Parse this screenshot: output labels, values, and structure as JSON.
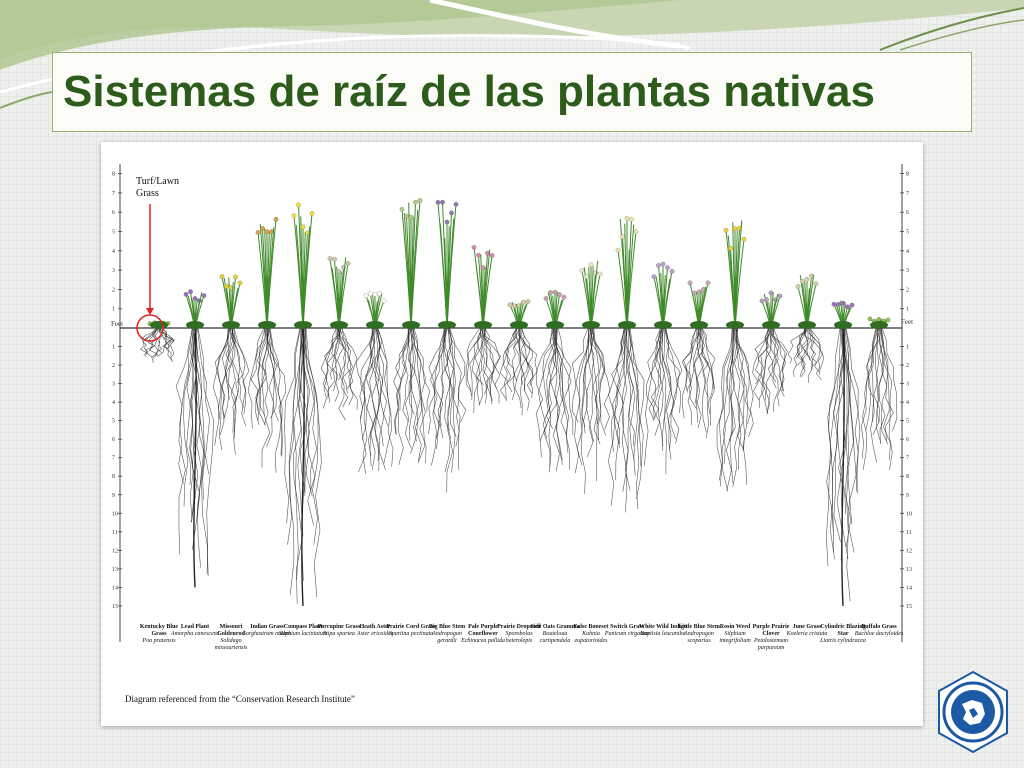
{
  "slide": {
    "title": "Sistemas de raíz de las plantas nativas"
  },
  "diagram": {
    "turf_label": "Turf/Lawn\nGrass",
    "feet_left": "Feet",
    "feet_right": "Feet",
    "caption": "Diagram referenced from the “Conservation Research Institute”",
    "depth_ticks_below": [
      "1",
      "2",
      "3",
      "4",
      "5",
      "6",
      "7",
      "8",
      "9",
      "10",
      "11",
      "12",
      "13",
      "14",
      "15"
    ],
    "height_ticks_above": [
      "1",
      "2",
      "3",
      "4",
      "5",
      "6",
      "7",
      "8"
    ],
    "plants": [
      {
        "common": "Kentucky Blue Grass",
        "scientific": "Poa pratensis",
        "root_depth_ft": 2,
        "height_ft": 0.3,
        "flower": "#7fbf3a"
      },
      {
        "common": "Lead Plant",
        "scientific": "Amorpha canescens",
        "root_depth_ft": 14,
        "height_ft": 2,
        "flower": "#9a6fc4"
      },
      {
        "common": "Missouri Goldenrod",
        "scientific": "Solidago missouriensis",
        "root_depth_ft": 7,
        "height_ft": 3,
        "flower": "#e4d23a"
      },
      {
        "common": "Indian Grass",
        "scientific": "Sorghastrum nutans",
        "root_depth_ft": 8,
        "height_ft": 7,
        "flower": "#d7a24a"
      },
      {
        "common": "Compass Plant",
        "scientific": "Silphium laciniatum",
        "root_depth_ft": 15,
        "height_ft": 7,
        "flower": "#f0e23a"
      },
      {
        "common": "Porcupine Grass",
        "scientific": "Stipa spartea",
        "root_depth_ft": 5,
        "height_ft": 4,
        "flower": "#c9c9b0"
      },
      {
        "common": "Heath Aster",
        "scientific": "Aster ericoides",
        "root_depth_ft": 8,
        "height_ft": 2,
        "flower": "#ffffff"
      },
      {
        "common": "Prairie Cord Grass",
        "scientific": "Spartina pectinata",
        "root_depth_ft": 8,
        "height_ft": 7,
        "flower": "#b9c98a"
      },
      {
        "common": "Big Blue Stem",
        "scientific": "Andropogon gerardii",
        "root_depth_ft": 9,
        "height_ft": 7,
        "flower": "#8a7bb0"
      },
      {
        "common": "Pale Purple Coneflower",
        "scientific": "Echinacea pallida",
        "root_depth_ft": 5,
        "height_ft": 4.5,
        "flower": "#d98ab8"
      },
      {
        "common": "Prairie Dropseed",
        "scientific": "Sporobolus heterolepis",
        "root_depth_ft": 5,
        "height_ft": 1.5,
        "flower": "#d6c7a8"
      },
      {
        "common": "Side Oats Gramma",
        "scientific": "Bouteloua curtipendula",
        "root_depth_ft": 8,
        "height_ft": 2,
        "flower": "#c8a0b0"
      },
      {
        "common": "False Boneset",
        "scientific": "Kuhnia eupatorioides",
        "root_depth_ft": 9,
        "height_ft": 4,
        "flower": "#e8e8d0"
      },
      {
        "common": "Switch Grass",
        "scientific": "Panicum virgatum",
        "root_depth_ft": 10,
        "height_ft": 6,
        "flower": "#e8e6b0"
      },
      {
        "common": "White Wild Indigo",
        "scientific": "Baptisia leucantha",
        "root_depth_ft": 8,
        "height_ft": 3.5,
        "flower": "#b9a0d0"
      },
      {
        "common": "Little Blue Stem",
        "scientific": "Andropogon scoparius",
        "root_depth_ft": 6,
        "height_ft": 2.5,
        "flower": "#c8a8b8"
      },
      {
        "common": "Rosin Weed",
        "scientific": "Silphium integrifolium",
        "root_depth_ft": 9,
        "height_ft": 6,
        "flower": "#f0d23a"
      },
      {
        "common": "Purple Prairie Clover",
        "scientific": "Petalostemum purpureum",
        "root_depth_ft": 5,
        "height_ft": 2,
        "flower": "#b0a0c0"
      },
      {
        "common": "June Grass",
        "scientific": "Koeleria cristata",
        "root_depth_ft": 3,
        "height_ft": 3,
        "flower": "#d0d0b0"
      },
      {
        "common": "Cylindric Blazing Star",
        "scientific": "Liatris cylindracea",
        "root_depth_ft": 15,
        "height_ft": 1.5,
        "flower": "#9a6fc4"
      },
      {
        "common": "Buffalo Grass",
        "scientific": "Buchloe dactyloides",
        "root_depth_ft": 8,
        "height_ft": 0.5,
        "flower": "#8fbf5a"
      }
    ]
  },
  "logo": {
    "icon": "conservation-seal-icon",
    "color": "#1d5aa6"
  },
  "colors": {
    "title": "#2d5b1b",
    "title_border": "#9bb06a",
    "turf_marker": "#e02020",
    "stem": "#3f8a2a",
    "root": "#222222"
  }
}
